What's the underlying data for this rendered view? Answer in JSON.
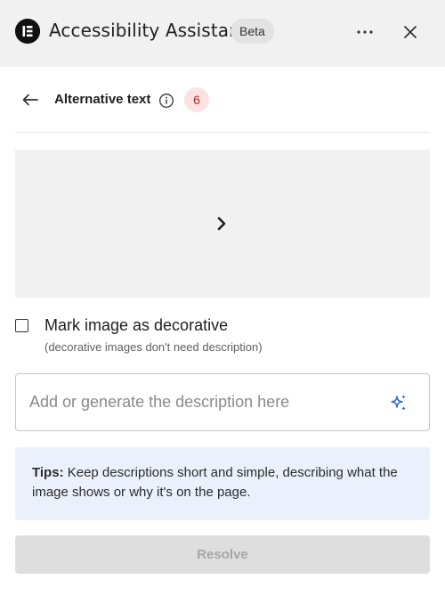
{
  "header": {
    "title": "Accessibility Assistant",
    "badge": "Beta",
    "logo_icon": "elementor-logo-icon",
    "more_icon": "more-horizontal-icon",
    "close_icon": "close-icon"
  },
  "subheader": {
    "back_icon": "arrow-left-icon",
    "title": "Alternative text",
    "info_icon": "info-icon",
    "issue_count": "6"
  },
  "image_preview": {
    "next_icon": "chevron-right-icon"
  },
  "decorative": {
    "checked": false,
    "label": "Mark image as decorative",
    "hint": "(decorative images don't need description)"
  },
  "description": {
    "value": "",
    "placeholder": "Add or generate the description here",
    "generate_icon": "sparkle-icon"
  },
  "tips": {
    "label": "Tips:",
    "text": " Keep descriptions short and simple, describing what the image shows or why it's on the page."
  },
  "actions": {
    "resolve_label": "Resolve",
    "resolve_disabled": true
  },
  "colors": {
    "header_bg": "#f1f1f1",
    "badge_error_bg": "#fbe3e3",
    "badge_error_text": "#b3261e",
    "tips_bg": "#eaf1fd",
    "accent": "#2d62d8"
  }
}
